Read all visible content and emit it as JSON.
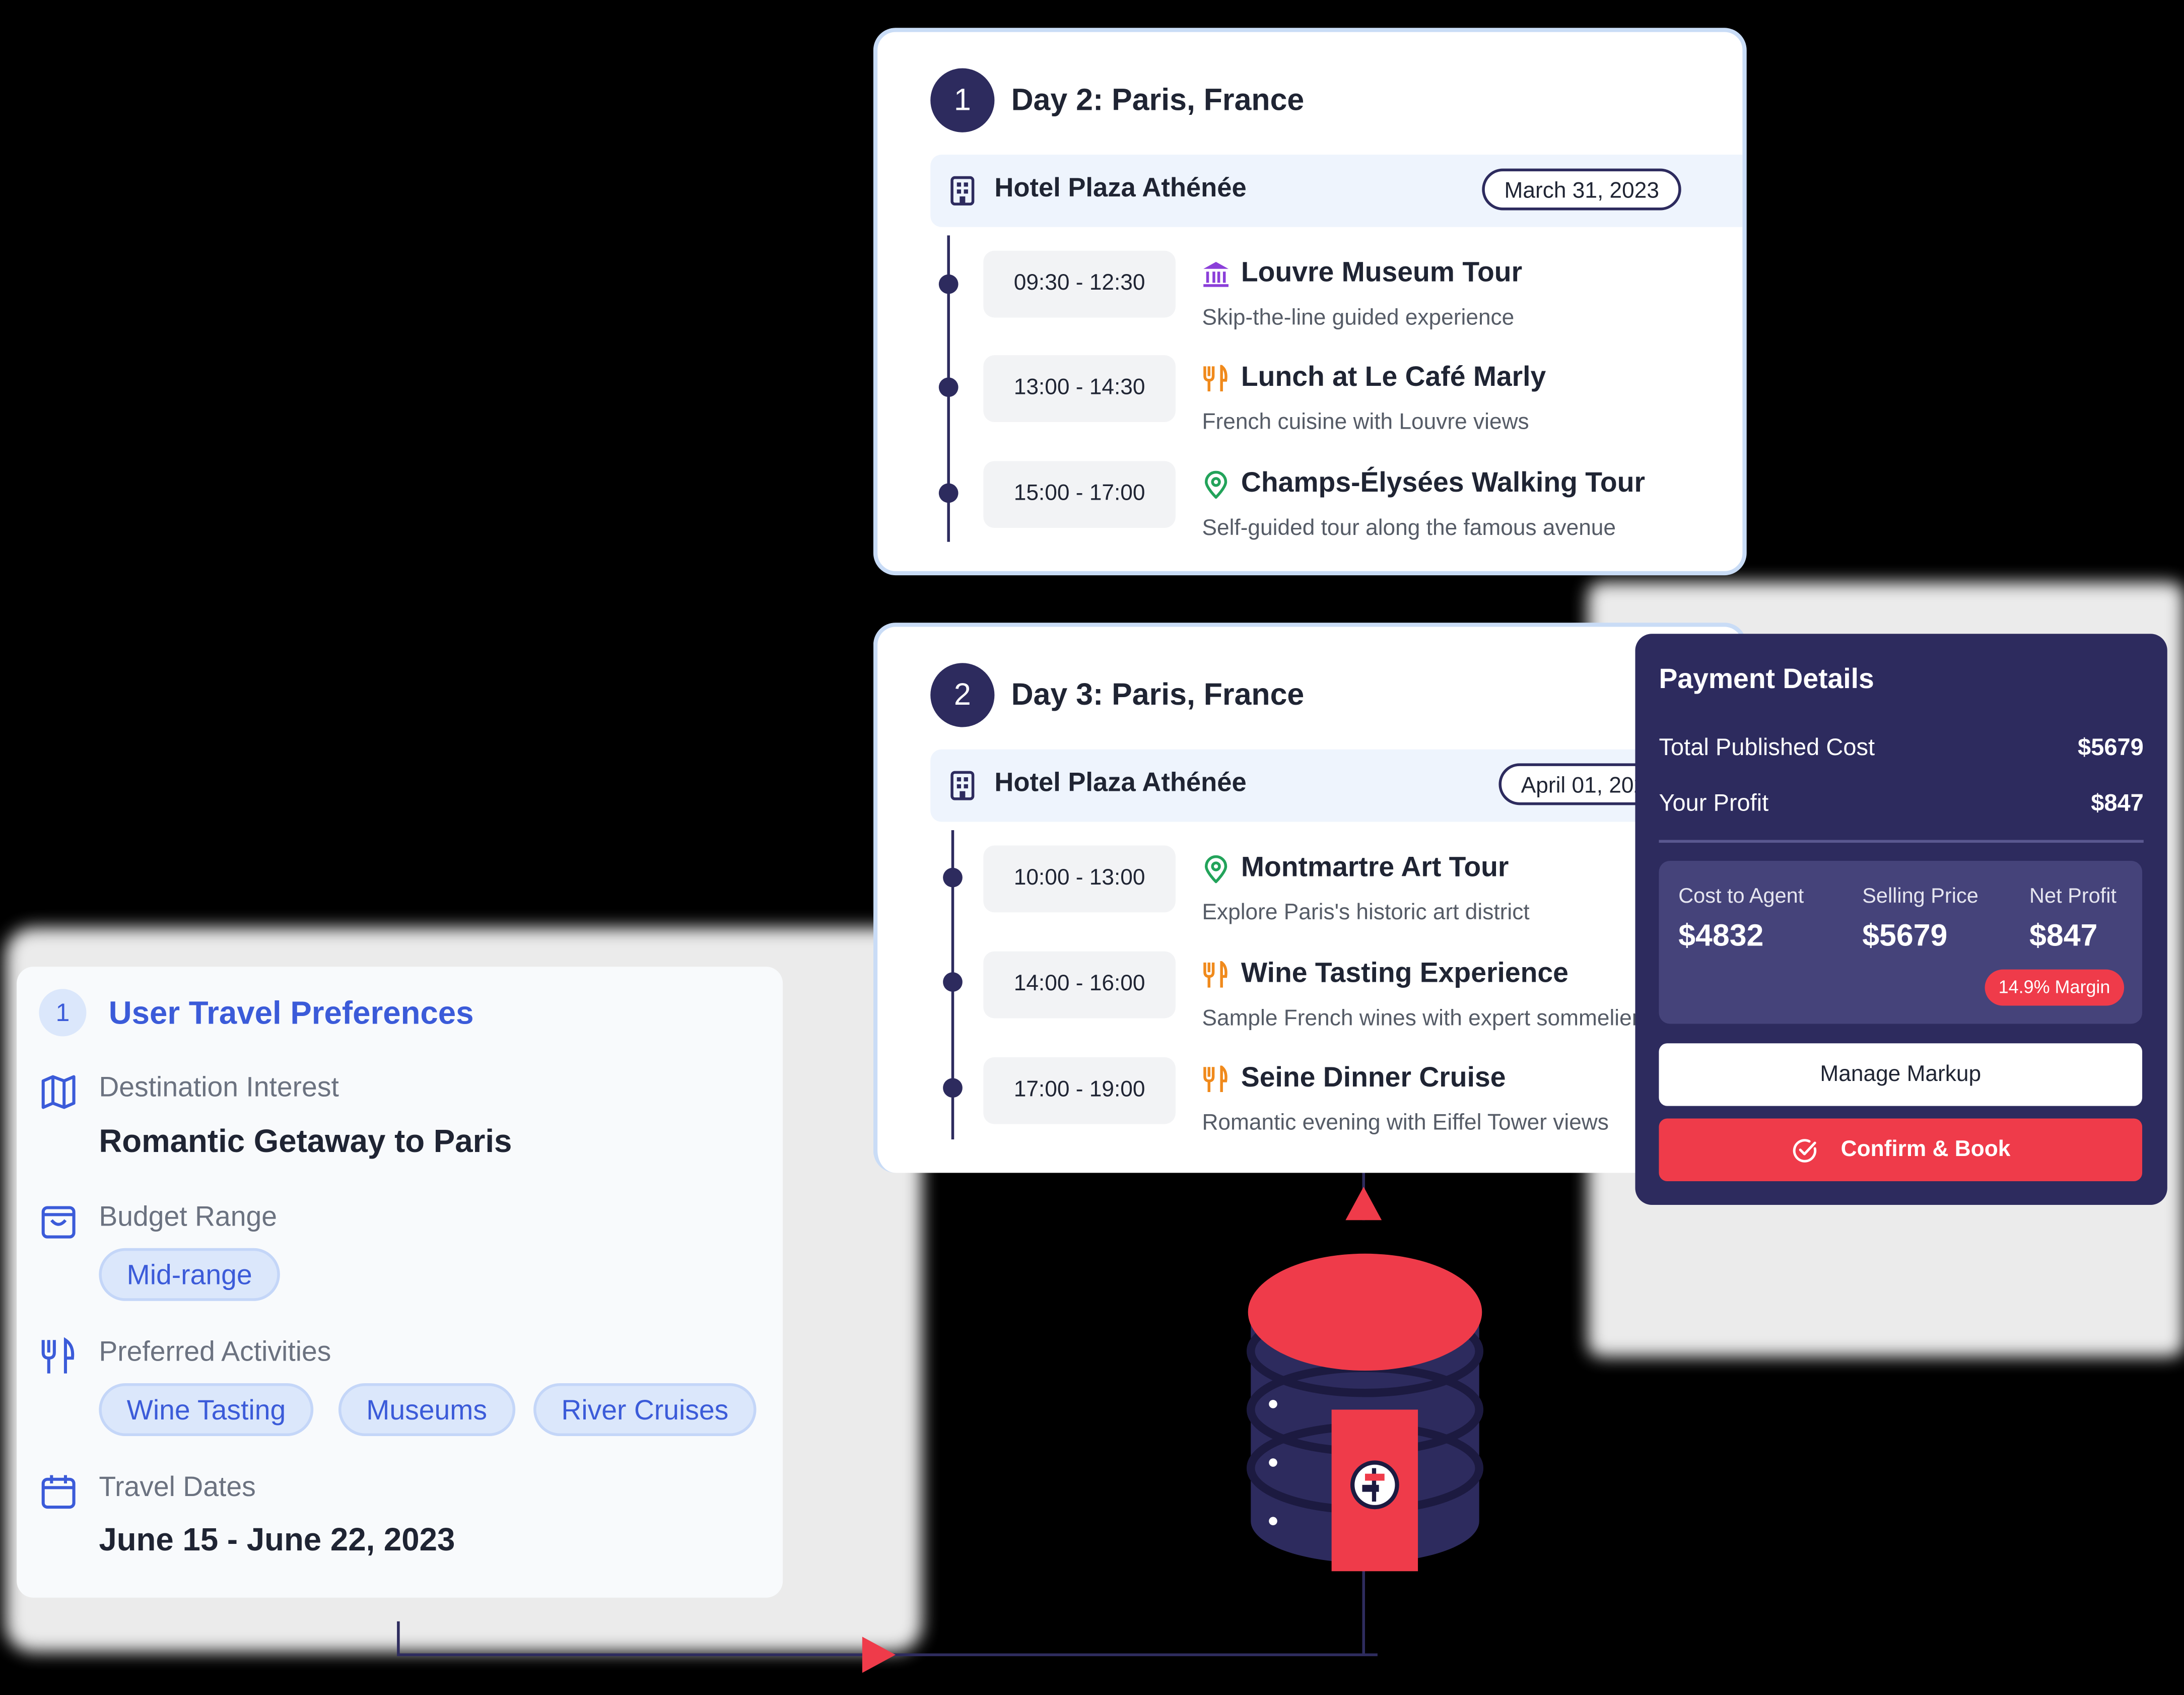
{
  "day_cards": [
    {
      "number": "1",
      "title": "Day 2: Paris, France",
      "hotel": "Hotel Plaza Athénée",
      "date": "March 31, 2023",
      "activities": [
        {
          "time": "09:30 - 12:30",
          "icon": "museum-icon",
          "title": "Louvre Museum Tour",
          "desc": "Skip-the-line guided experience"
        },
        {
          "time": "13:00 - 14:30",
          "icon": "fork-knife-icon",
          "title": "Lunch at Le Café Marly",
          "desc": "French cuisine with Louvre views"
        },
        {
          "time": "15:00 - 17:00",
          "icon": "map-pin-icon",
          "title": "Champs-Élysées Walking Tour",
          "desc": "Self-guided tour along the famous avenue"
        }
      ]
    },
    {
      "number": "2",
      "title": "Day 3: Paris, France",
      "hotel": "Hotel Plaza Athénée",
      "date": "April 01, 2023",
      "activities": [
        {
          "time": "10:00 - 13:00",
          "icon": "map-pin-icon",
          "title": "Montmartre Art Tour",
          "desc": "Explore Paris's historic art district"
        },
        {
          "time": "14:00 - 16:00",
          "icon": "fork-knife-icon",
          "title": "Wine Tasting Experience",
          "desc": "Sample French wines with expert sommelier"
        },
        {
          "time": "17:00 - 19:00",
          "icon": "fork-knife-icon",
          "title": "Seine Dinner Cruise",
          "desc": "Romantic evening with Eiffel Tower views"
        }
      ]
    }
  ],
  "preferences": {
    "number": "1",
    "title": "User Travel Preferences",
    "destination_label": "Destination Interest",
    "destination_value": "Romantic Getaway to Paris",
    "budget_label": "Budget Range",
    "budget_value": "Mid-range",
    "activities_label": "Preferred Activities",
    "activities": [
      "Wine Tasting",
      "Museums",
      "River Cruises"
    ],
    "dates_label": "Travel Dates",
    "dates_value": "June 15 - June 22, 2023"
  },
  "payment": {
    "title": "Payment Details",
    "total_label": "Total Published Cost",
    "total_value": "$5679",
    "profit_label": "Your Profit",
    "profit_value": "$847",
    "cost_agent_label": "Cost to Agent",
    "cost_agent_value": "$4832",
    "selling_label": "Selling Price",
    "selling_value": "$5679",
    "net_label": "Net Profit",
    "net_value": "$847",
    "margin_badge": "14.9% Margin",
    "manage_button": "Manage Markup",
    "confirm_button": "Confirm & Book"
  },
  "colors": {
    "navy": "#2d2b5e",
    "accent_red": "#ef3b4a",
    "accent_blue": "#3b5bd9"
  }
}
